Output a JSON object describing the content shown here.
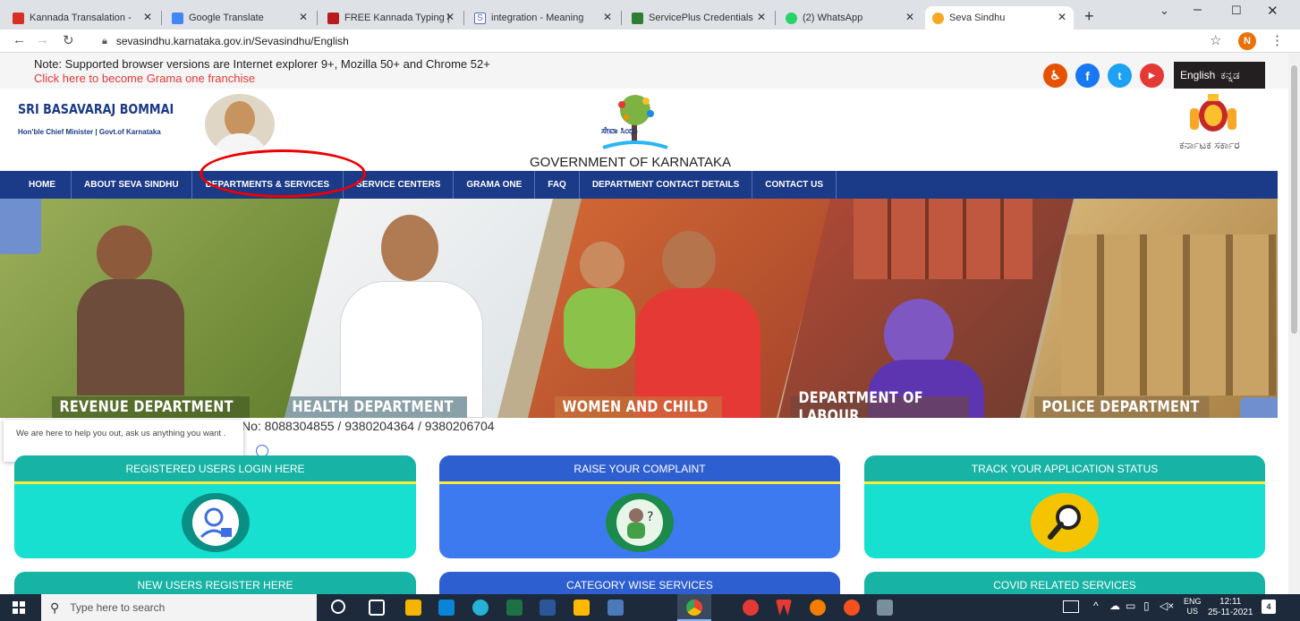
{
  "browser": {
    "tabs": [
      {
        "label": "Kannada Transalation -",
        "favicon_color": "#d93025"
      },
      {
        "label": "Google Translate",
        "favicon_color": "#4285f4"
      },
      {
        "label": "FREE Kannada Typing |",
        "favicon_color": "#b71c1c"
      },
      {
        "label": "integration - Meaning",
        "favicon_color": "#5c6bc0"
      },
      {
        "label": "ServicePlus Credentials",
        "favicon_color": "#2e7d32"
      },
      {
        "label": "(2) WhatsApp",
        "favicon_color": "#25d366"
      },
      {
        "label": "Seva Sindhu",
        "favicon_color": "#f9a825"
      }
    ],
    "url": "sevasindhu.karnataka.gov.in/Sevasindhu/English",
    "profile_initial": "N"
  },
  "notebar": {
    "note": "Note: Supported browser versions are Internet explorer 9+, Mozilla 50+ and Chrome 52+",
    "franchise_link": "Click here to become Grama one franchise",
    "lang_english": "English",
    "lang_kannada": "ಕನ್ನಡ"
  },
  "header": {
    "cm_name": "SRI BASAVARAJ BOMMAI",
    "cm_title": "Hon'ble Chief Minister | Govt.of Karnataka",
    "gov_title": "GOVERNMENT OF KARNATAKA",
    "emblem_text": "ಕರ್ನಾಟಕ ಸರ್ಕಾರ",
    "logo_text": "ಸೇವಾ ಸಿಂಧು"
  },
  "nav": [
    "HOME",
    "ABOUT SEVA SINDHU",
    "DEPARTMENTS & SERVICES",
    "SERVICE CENTERS",
    "GRAMA ONE",
    "FAQ",
    "DEPARTMENT CONTACT DETAILS",
    "CONTACT US"
  ],
  "banner": [
    {
      "label": "REVENUE DEPARTMENT",
      "color": "#7a8a3a"
    },
    {
      "label": "HEALTH DEPARTMENT",
      "color": "#cfd8dc"
    },
    {
      "label": "WOMEN AND CHILD",
      "color": "#c25b2e"
    },
    {
      "label": "DEPARTMENT OF LABOUR",
      "color": "#8b4a3a"
    },
    {
      "label": "POLICE DEPARTMENT",
      "color": "#b08c52"
    }
  ],
  "helpline": "No: 8088304855 / 9380204364 / 9380206704",
  "chat": "We are here to help you out, ask us anything you want .",
  "cards": [
    {
      "title": "REGISTERED USERS LOGIN HERE",
      "color": "#17c9b8"
    },
    {
      "title": "RAISE YOUR COMPLAINT",
      "color": "#3d6fe0"
    },
    {
      "title": "TRACK YOUR APPLICATION STATUS",
      "color": "#17c9b8"
    }
  ],
  "cards_row2": [
    "NEW USERS REGISTER HERE",
    "CATEGORY WISE SERVICES",
    "COVID RELATED SERVICES"
  ],
  "taskbar": {
    "search_placeholder": "Type here to search",
    "lang": "ENG",
    "region": "US",
    "time": "12:11",
    "date": "25-11-2021",
    "notif_count": "4"
  }
}
